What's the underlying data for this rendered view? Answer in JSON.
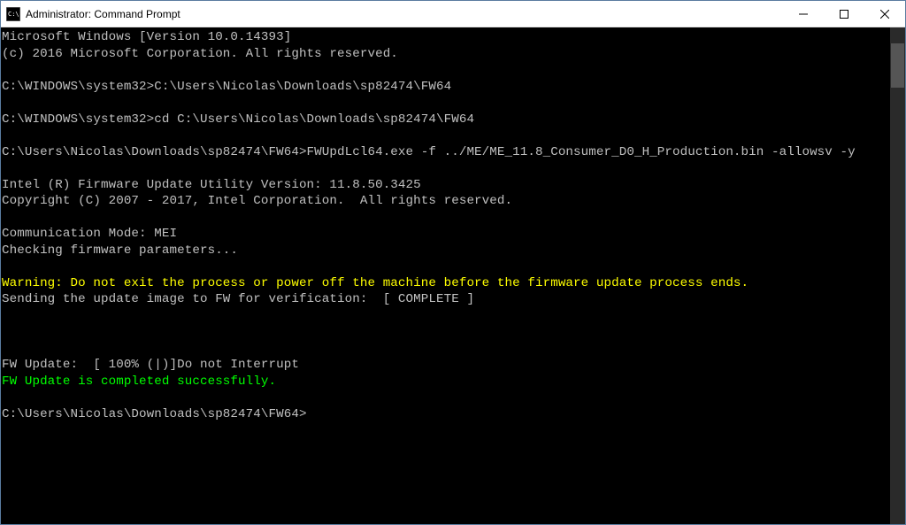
{
  "window": {
    "title": "Administrator: Command Prompt"
  },
  "terminal": {
    "lines": [
      {
        "text": "Microsoft Windows [Version 10.0.14393]",
        "color": ""
      },
      {
        "text": "(c) 2016 Microsoft Corporation. All rights reserved.",
        "color": ""
      },
      {
        "text": "",
        "color": ""
      },
      {
        "text": "C:\\WINDOWS\\system32>C:\\Users\\Nicolas\\Downloads\\sp82474\\FW64",
        "color": ""
      },
      {
        "text": "",
        "color": ""
      },
      {
        "text": "C:\\WINDOWS\\system32>cd C:\\Users\\Nicolas\\Downloads\\sp82474\\FW64",
        "color": ""
      },
      {
        "text": "",
        "color": ""
      },
      {
        "text": "C:\\Users\\Nicolas\\Downloads\\sp82474\\FW64>FWUpdLcl64.exe -f ../ME/ME_11.8_Consumer_D0_H_Production.bin -allowsv -y",
        "color": ""
      },
      {
        "text": "",
        "color": ""
      },
      {
        "text": "Intel (R) Firmware Update Utility Version: 11.8.50.3425",
        "color": ""
      },
      {
        "text": "Copyright (C) 2007 - 2017, Intel Corporation.  All rights reserved.",
        "color": ""
      },
      {
        "text": "",
        "color": ""
      },
      {
        "text": "Communication Mode: MEI",
        "color": ""
      },
      {
        "text": "Checking firmware parameters...",
        "color": ""
      },
      {
        "text": "",
        "color": ""
      },
      {
        "text": "Warning: Do not exit the process or power off the machine before the firmware update process ends.",
        "color": "yellow"
      },
      {
        "text": "Sending the update image to FW for verification:  [ COMPLETE ]",
        "color": ""
      },
      {
        "text": "",
        "color": ""
      },
      {
        "text": "",
        "color": ""
      },
      {
        "text": "",
        "color": ""
      },
      {
        "text": "FW Update:  [ 100% (|)]Do not Interrupt",
        "color": ""
      },
      {
        "text": "FW Update is completed successfully.",
        "color": "green"
      },
      {
        "text": "",
        "color": ""
      },
      {
        "text": "C:\\Users\\Nicolas\\Downloads\\sp82474\\FW64>",
        "color": ""
      }
    ]
  }
}
